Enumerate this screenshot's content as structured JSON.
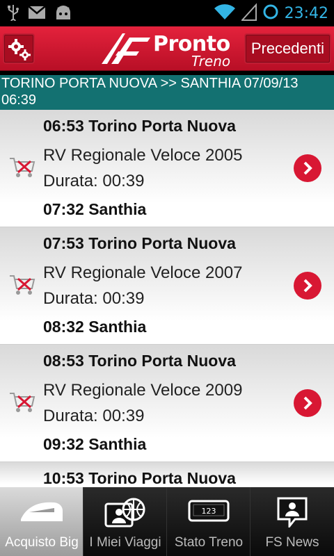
{
  "status_bar": {
    "time": "23:42",
    "left_icons": [
      "usb-icon",
      "gmail-icon",
      "android-icon"
    ],
    "right_icons": [
      "wifi-icon",
      "signal-icon",
      "sync-icon"
    ]
  },
  "action_bar": {
    "logo_title": "Pronto",
    "logo_subtitle": "Treno",
    "previous_label": "Precedenti",
    "settings_icon": "settings-icon"
  },
  "route": {
    "text": "TORINO PORTA NUOVA >> SANTHIA 07/09/13 06:39"
  },
  "trains": [
    {
      "departure": "06:53 Torino Porta Nuova",
      "train": "RV Regionale Veloce 2005",
      "duration": "Durata: 00:39",
      "arrival": "07:32 Santhia"
    },
    {
      "departure": "07:53 Torino Porta Nuova",
      "train": "RV Regionale Veloce 2007",
      "duration": "Durata: 00:39",
      "arrival": "08:32 Santhia"
    },
    {
      "departure": "08:53 Torino Porta Nuova",
      "train": "RV Regionale Veloce 2009",
      "duration": "Durata: 00:39",
      "arrival": "09:32 Santhia"
    },
    {
      "departure": "10:53 Torino Porta Nuova"
    }
  ],
  "tabs": [
    {
      "label": "Acquisto Big",
      "icon": "train-icon",
      "active": true
    },
    {
      "label": "I Miei Viaggi",
      "icon": "my-trips-icon",
      "active": false
    },
    {
      "label": "Stato Treno",
      "icon": "train-status-icon",
      "icon_text": "123",
      "active": false
    },
    {
      "label": "FS News",
      "icon": "news-icon",
      "active": false
    }
  ],
  "colors": {
    "brand_red": "#d81733",
    "header_teal": "#137171",
    "status_blue": "#33b5e5"
  }
}
